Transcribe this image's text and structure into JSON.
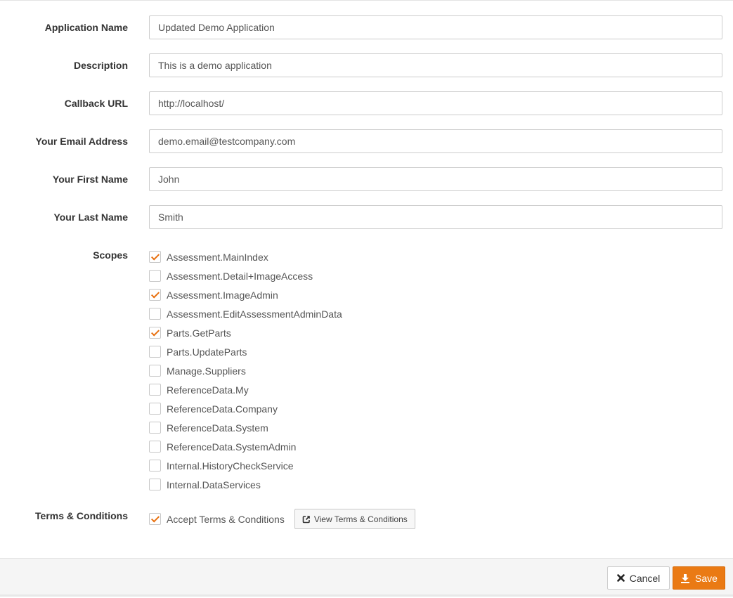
{
  "form": {
    "fields": [
      {
        "label": "Application Name",
        "value": "Updated Demo Application"
      },
      {
        "label": "Description",
        "value": "This is a demo application"
      },
      {
        "label": "Callback URL",
        "value": "http://localhost/"
      },
      {
        "label": "Your Email Address",
        "value": "demo.email@testcompany.com"
      },
      {
        "label": "Your First Name",
        "value": "John"
      },
      {
        "label": "Your Last Name",
        "value": "Smith"
      }
    ],
    "scopes_label": "Scopes",
    "scopes": [
      {
        "label": "Assessment.MainIndex",
        "checked": true
      },
      {
        "label": "Assessment.Detail+ImageAccess",
        "checked": false
      },
      {
        "label": "Assessment.ImageAdmin",
        "checked": true
      },
      {
        "label": "Assessment.EditAssessmentAdminData",
        "checked": false
      },
      {
        "label": "Parts.GetParts",
        "checked": true
      },
      {
        "label": "Parts.UpdateParts",
        "checked": false
      },
      {
        "label": "Manage.Suppliers",
        "checked": false
      },
      {
        "label": "ReferenceData.My",
        "checked": false
      },
      {
        "label": "ReferenceData.Company",
        "checked": false
      },
      {
        "label": "ReferenceData.System",
        "checked": false
      },
      {
        "label": "ReferenceData.SystemAdmin",
        "checked": false
      },
      {
        "label": "Internal.HistoryCheckService",
        "checked": false
      },
      {
        "label": "Internal.DataServices",
        "checked": false
      }
    ],
    "terms_label": "Terms & Conditions",
    "accept_terms_label": "Accept Terms & Conditions",
    "accept_terms_checked": true,
    "view_terms_label": "View Terms & Conditions",
    "view_terms_icon": "external-link-icon"
  },
  "footer": {
    "cancel_label": "Cancel",
    "cancel_icon": "close-icon",
    "save_label": "Save",
    "save_icon": "download-icon"
  },
  "colors": {
    "accent": "#ea7a14",
    "checkmark": "#e8700f"
  }
}
